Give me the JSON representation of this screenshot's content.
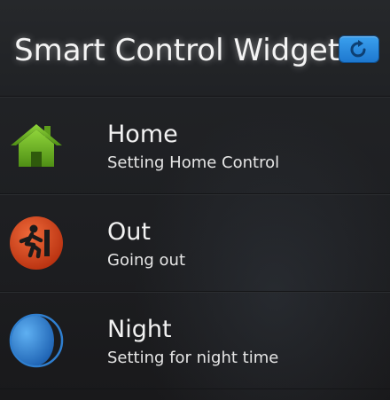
{
  "header": {
    "title": "Smart Control Widget",
    "refresh_icon": "refresh-icon"
  },
  "items": [
    {
      "label": "Home",
      "subtitle": "Setting Home Control",
      "icon": "home-icon",
      "color": "#6fb621"
    },
    {
      "label": "Out",
      "subtitle": "Going out",
      "icon": "running-person-icon",
      "color": "#d6421d"
    },
    {
      "label": "Night",
      "subtitle": "Setting for night time",
      "icon": "moon-icon",
      "color": "#2f7fd0"
    }
  ],
  "colors": {
    "background": "#1d1e21",
    "accent_blue": "#1e78cf"
  }
}
